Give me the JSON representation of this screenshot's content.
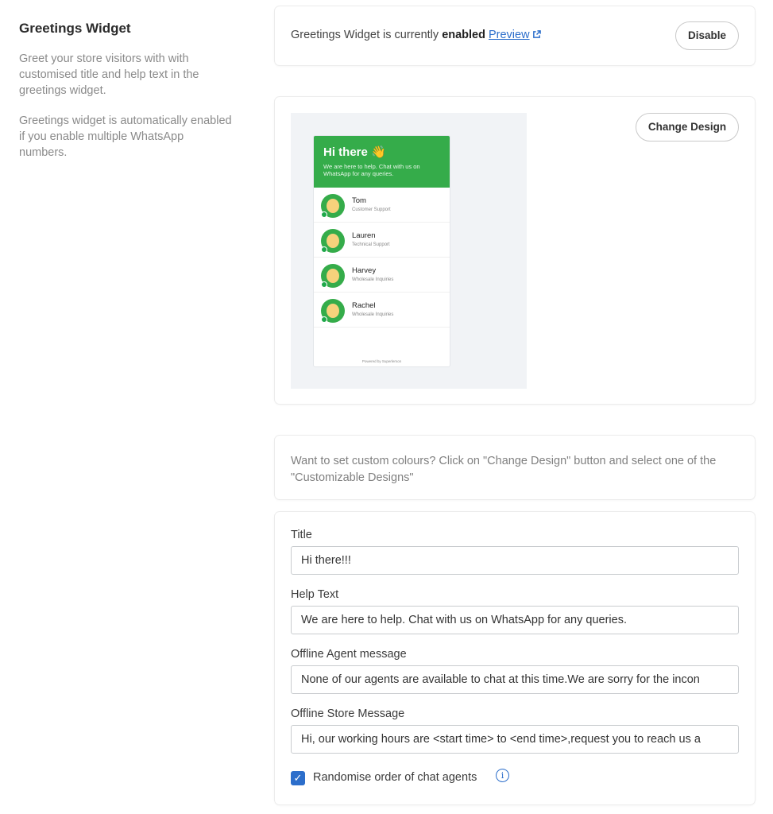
{
  "sidebar": {
    "title": "Greetings Widget",
    "description_1": "Greet your store visitors with with customised title and help text in the greetings widget.",
    "description_2": "Greetings widget is automatically enabled if you enable multiple WhatsApp numbers."
  },
  "status": {
    "prefix": "Greetings Widget is currently ",
    "state": "enabled",
    "preview_label": "Preview",
    "disable_label": "Disable"
  },
  "design": {
    "change_label": "Change Design",
    "widget_title": "Hi there 👋",
    "widget_subtitle": "We are here to help. Chat with us on WhatsApp for any queries.",
    "agents": [
      {
        "name": "Tom",
        "role": "Customer Support"
      },
      {
        "name": "Lauren",
        "role": "Technical Support"
      },
      {
        "name": "Harvey",
        "role": "Wholesale Inquiries"
      },
      {
        "name": "Rachel",
        "role": "Wholesale Inquiries"
      }
    ],
    "powered_by": "Powered by Superlemon"
  },
  "hint": {
    "text": "Want to set custom colours? Click on \"Change Design\" button and select one of the \"Customizable Designs\""
  },
  "form": {
    "title_label": "Title",
    "title_value": "Hi there!!!",
    "help_label": "Help Text",
    "help_value": "We are here to help. Chat with us on WhatsApp for any queries.",
    "offline_agent_label": "Offline Agent message",
    "offline_agent_value": "None of our agents are available to chat at this time.We are sorry for the incon",
    "offline_store_label": "Offline Store Message",
    "offline_store_value": "Hi, our working hours are <start time> to <end time>,request you to reach us a",
    "randomise_label": "Randomise order of chat agents",
    "randomise_checked": true
  },
  "colors": {
    "accent": "#2c6ecb",
    "widget_green": "#35ac4a"
  }
}
